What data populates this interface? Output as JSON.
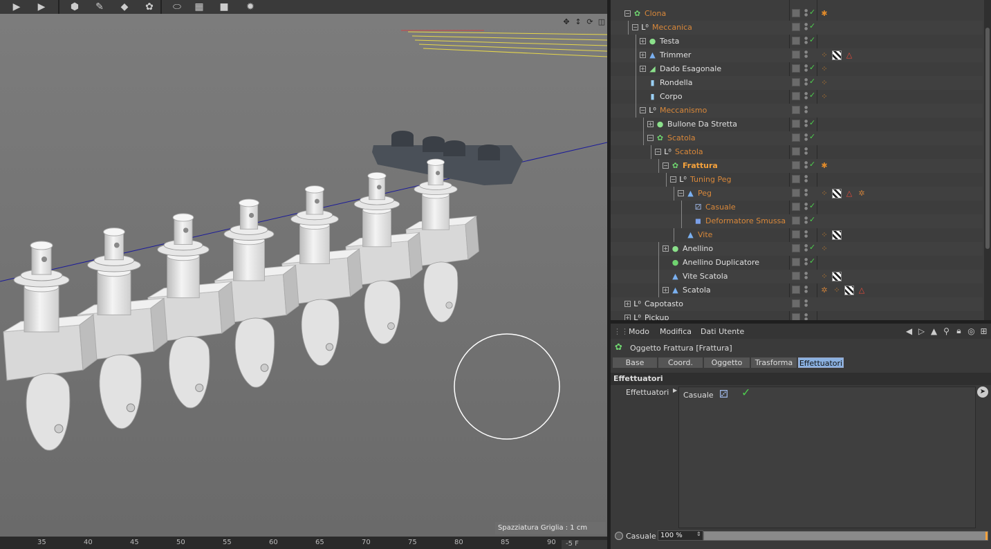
{
  "toolbar": {
    "buttons": [
      {
        "name": "render-view-icon",
        "glyph": "▶"
      },
      {
        "name": "render-settings-icon",
        "glyph": "▶"
      },
      {
        "name": "cube-icon",
        "glyph": "⬢"
      },
      {
        "name": "spline-pen-icon",
        "glyph": "✎"
      },
      {
        "name": "subdivision-icon",
        "glyph": "◆"
      },
      {
        "name": "mograph-cloner-icon",
        "glyph": "✿"
      },
      {
        "name": "deformer-icon",
        "glyph": "⬭"
      },
      {
        "name": "floor-icon",
        "glyph": "▦"
      },
      {
        "name": "camera-icon",
        "glyph": "■"
      },
      {
        "name": "light-icon",
        "glyph": "✹"
      }
    ]
  },
  "viewport": {
    "grid_spacing": "Spazziatura Griglia : 1 cm",
    "nav_icons": [
      "✥",
      "↕",
      "⟳",
      "◫"
    ]
  },
  "ruler": {
    "numbers": [
      "35",
      "40",
      "45",
      "50",
      "55",
      "60",
      "65",
      "70",
      "75",
      "80",
      "85",
      "90"
    ],
    "end_label": "-5 F"
  },
  "objects": [
    {
      "name": "Clona",
      "style": "orange",
      "indent": 0,
      "expander": "minus",
      "icon": "✿",
      "iconColor": "#6fd36f",
      "check": true,
      "tags": [
        "pin"
      ]
    },
    {
      "name": "Meccanica",
      "style": "orange",
      "indent": 1,
      "expander": "minus",
      "icon": "L⁰",
      "iconColor": "#eee",
      "check": true,
      "tags": []
    },
    {
      "name": "Testa",
      "style": "white",
      "indent": 2,
      "expander": "plus",
      "icon": "●",
      "iconColor": "#8be08b",
      "check": true,
      "tags": []
    },
    {
      "name": "Trimmer",
      "style": "white",
      "indent": 2,
      "expander": "plus",
      "icon": "▲",
      "iconColor": "#7ab0f0",
      "check": false,
      "tags": [
        "dots",
        "checker",
        "warn"
      ]
    },
    {
      "name": "Dado Esagonale",
      "style": "white",
      "indent": 2,
      "expander": "plus",
      "icon": "◢",
      "iconColor": "#8be08b",
      "check": true,
      "tags": [
        "dots"
      ]
    },
    {
      "name": "Rondella",
      "style": "white",
      "indent": 2,
      "expander": "none",
      "icon": "▮",
      "iconColor": "#9ad0f5",
      "check": true,
      "tags": [
        "dots"
      ]
    },
    {
      "name": "Corpo",
      "style": "white",
      "indent": 2,
      "expander": "none",
      "icon": "▮",
      "iconColor": "#9ad0f5",
      "check": true,
      "tags": [
        "dots"
      ]
    },
    {
      "name": "Meccanismo",
      "style": "orange",
      "indent": 2,
      "expander": "minus",
      "icon": "L⁰",
      "iconColor": "#eee",
      "check": false,
      "tags": []
    },
    {
      "name": "Bullone Da Stretta",
      "style": "white",
      "indent": 3,
      "expander": "plus",
      "icon": "●",
      "iconColor": "#8be08b",
      "check": true,
      "tags": []
    },
    {
      "name": "Scatola",
      "style": "orange",
      "indent": 3,
      "expander": "minus",
      "icon": "✿",
      "iconColor": "#6fd36f",
      "check": true,
      "tags": []
    },
    {
      "name": "Scatola",
      "style": "orange",
      "indent": 4,
      "expander": "minus",
      "icon": "L⁰",
      "iconColor": "#eee",
      "check": false,
      "tags": []
    },
    {
      "name": "Frattura",
      "style": "bold",
      "indent": 5,
      "expander": "minus",
      "icon": "✿",
      "iconColor": "#6fd36f",
      "check": true,
      "tags": [
        "pin"
      ]
    },
    {
      "name": "Tuning Peg",
      "style": "orange",
      "indent": 6,
      "expander": "minus",
      "icon": "L⁰",
      "iconColor": "#eee",
      "check": false,
      "tags": []
    },
    {
      "name": "Peg",
      "style": "orange",
      "indent": 7,
      "expander": "minus",
      "icon": "▲",
      "iconColor": "#7ab0f0",
      "check": false,
      "tags": [
        "dots",
        "checker",
        "warn",
        "bug"
      ]
    },
    {
      "name": "Casuale",
      "style": "orange",
      "indent": 8,
      "expander": "none",
      "icon": "⚂",
      "iconColor": "#9fb8e8",
      "check": true,
      "tags": []
    },
    {
      "name": "Deformatore Smussa",
      "style": "orange",
      "indent": 8,
      "expander": "none",
      "icon": "◼",
      "iconColor": "#7a9fe8",
      "check": true,
      "tags": []
    },
    {
      "name": "Vite",
      "style": "orange",
      "indent": 7,
      "expander": "none",
      "icon": "▲",
      "iconColor": "#7ab0f0",
      "check": false,
      "tags": [
        "dots",
        "checker"
      ]
    },
    {
      "name": "Anellino",
      "style": "white",
      "indent": 5,
      "expander": "plus",
      "icon": "●",
      "iconColor": "#8be08b",
      "check": true,
      "tags": [
        "dots"
      ]
    },
    {
      "name": "Anellino Duplicatore",
      "style": "white",
      "indent": 5,
      "expander": "none",
      "icon": "●",
      "iconColor": "#6fd36f",
      "check": true,
      "tags": []
    },
    {
      "name": "Vite Scatola",
      "style": "white",
      "indent": 5,
      "expander": "none",
      "icon": "▲",
      "iconColor": "#7ab0f0",
      "check": false,
      "tags": [
        "dots",
        "checker"
      ]
    },
    {
      "name": "Scatola",
      "style": "white",
      "indent": 5,
      "expander": "plus",
      "icon": "▲",
      "iconColor": "#7ab0f0",
      "check": false,
      "tags": [
        "bug",
        "dots",
        "checker",
        "warn"
      ]
    },
    {
      "name": "Capotasto",
      "style": "white",
      "indent": 0,
      "expander": "plus",
      "icon": "L⁰",
      "iconColor": "#eee",
      "check": false,
      "tags": []
    },
    {
      "name": "Pickup",
      "style": "white",
      "indent": 0,
      "expander": "plus",
      "icon": "L⁰",
      "iconColor": "#eee",
      "check": false,
      "tags": []
    }
  ],
  "attributes": {
    "menu": [
      "Modo",
      "Modifica",
      "Dati Utente"
    ],
    "title": "Oggetto Frattura [Frattura]",
    "tabs": [
      {
        "label": "Base",
        "active": false
      },
      {
        "label": "Coord.",
        "active": false
      },
      {
        "label": "Oggetto",
        "active": false
      },
      {
        "label": "Trasforma",
        "active": false
      },
      {
        "label": "Effettuatori",
        "active": true
      }
    ],
    "section": "Effettuatori",
    "field_label": "Effettuatori",
    "list_item": "Casuale",
    "slider_label": "Casuale",
    "slider_value": "100 %",
    "slider_fraction": 1.0
  }
}
